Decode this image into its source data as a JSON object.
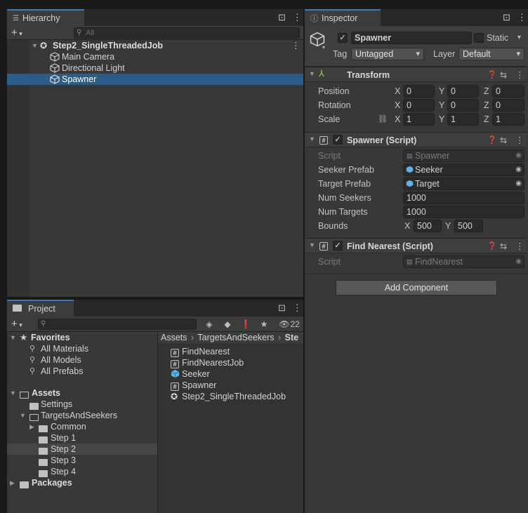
{
  "hierarchy": {
    "tab_label": "Hierarchy",
    "search_placeholder": "All",
    "items": [
      {
        "label": "Step2_SingleThreadedJob"
      },
      {
        "label": "Main Camera"
      },
      {
        "label": "Directional Light"
      },
      {
        "label": "Spawner"
      }
    ]
  },
  "project": {
    "tab_label": "Project",
    "hidden_count": "22",
    "favorites_label": "Favorites",
    "favorites": [
      "All Materials",
      "All Models",
      "All Prefabs"
    ],
    "assets_label": "Assets",
    "tree": [
      "Settings",
      "TargetsAndSeekers",
      "Common",
      "Step 1",
      "Step 2",
      "Step 3",
      "Step 4"
    ],
    "packages_label": "Packages",
    "breadcrumb": [
      "Assets",
      "TargetsAndSeekers",
      "Ste"
    ],
    "files": [
      "FindNearest",
      "FindNearestJob",
      "Seeker",
      "Spawner",
      "Step2_SingleThreadedJob"
    ]
  },
  "inspector": {
    "tab_label": "Inspector",
    "object_name": "Spawner",
    "static_label": "Static",
    "tag_label": "Tag",
    "tag_value": "Untagged",
    "layer_label": "Layer",
    "layer_value": "Default",
    "transform": {
      "title": "Transform",
      "position_label": "Position",
      "rotation_label": "Rotation",
      "scale_label": "Scale",
      "axis_x": "X",
      "axis_y": "Y",
      "axis_z": "Z",
      "position": [
        "0",
        "0",
        "0"
      ],
      "rotation": [
        "0",
        "0",
        "0"
      ],
      "scale": [
        "1",
        "1",
        "1"
      ]
    },
    "spawner": {
      "title": "Spawner (Script)",
      "script_label": "Script",
      "script_value": "Spawner",
      "seeker_prefab_label": "Seeker Prefab",
      "seeker_prefab_value": "Seeker",
      "target_prefab_label": "Target Prefab",
      "target_prefab_value": "Target",
      "num_seekers_label": "Num Seekers",
      "num_seekers_value": "1000",
      "num_targets_label": "Num Targets",
      "num_targets_value": "1000",
      "bounds_label": "Bounds",
      "bounds_x": "500",
      "bounds_y": "500"
    },
    "find_nearest": {
      "title": "Find Nearest (Script)",
      "script_label": "Script",
      "script_value": "FindNearest"
    },
    "add_component_label": "Add Component"
  },
  "colors": {
    "selection": "#2c5d87",
    "tab_accent": "#3a79bb",
    "panel_bg": "#383838"
  }
}
